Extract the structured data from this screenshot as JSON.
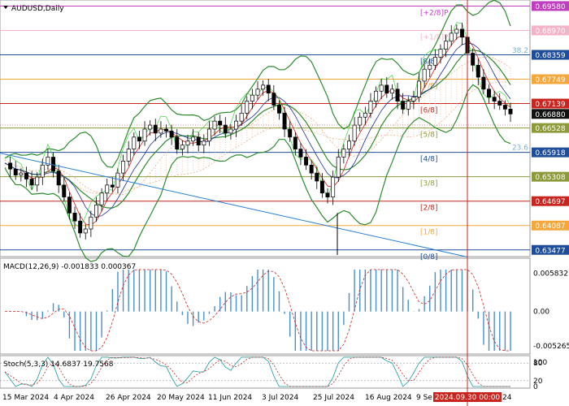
{
  "chart_data": {
    "type": "candlestick",
    "symbol_label": "AUDUSD,Daily",
    "x_ticks": [
      "15 Mar 2024",
      "4 Apr 2024",
      "26 Apr 2024",
      "20 May 2024",
      "11 Jun 2024",
      "3 Jul 2024",
      "25 Jul 2024",
      "16 Aug 2024",
      "9 Se"
    ],
    "x_tail_label": "24",
    "cursor_time": "2024.09.30 00:00",
    "price_panel": {
      "ylim": [
        0.6335,
        0.6965
      ],
      "cursor_price": "0.6688",
      "price_tags": [
        {
          "value": 0.6958,
          "label": "0.69580",
          "color": "#c03ec0"
        },
        {
          "value": 0.6897,
          "label": "0.68970",
          "color": "#f3b3c8"
        },
        {
          "value": 0.68359,
          "label": "0.68359",
          "color": "#1f4d9a"
        },
        {
          "value": 0.67749,
          "label": "0.67749",
          "color": "#f4a73a"
        },
        {
          "value": 0.67139,
          "label": "0.67139",
          "color": "#c8251f"
        },
        {
          "value": 0.6688,
          "label": "0.66880",
          "color": "#111111"
        },
        {
          "value": 0.66528,
          "label": "0.66528",
          "color": "#8e9a3a"
        },
        {
          "value": 0.65918,
          "label": "0.65918",
          "color": "#1f4d9a"
        },
        {
          "value": 0.65308,
          "label": "0.65308",
          "color": "#8e9a3a"
        },
        {
          "value": 0.64697,
          "label": "0.64697",
          "color": "#c8251f"
        },
        {
          "value": 0.64087,
          "label": "0.64087",
          "color": "#f4a73a"
        },
        {
          "value": 0.63477,
          "label": "0.63477",
          "color": "#1f4d9a"
        }
      ],
      "murrey_levels": [
        {
          "label": "[+2/8]P",
          "value": 0.6958,
          "color": "#c03ec0"
        },
        {
          "label": "[+1/8]P",
          "value": 0.6897,
          "color": "#f3b3c8"
        },
        {
          "label": "[8/8]",
          "value": 0.68359,
          "color": "#1f4d9a"
        },
        {
          "label": "[7/8]",
          "value": 0.67749,
          "color": "#f4a73a"
        },
        {
          "label": "[6/8]",
          "value": 0.67139,
          "color": "#c8251f"
        },
        {
          "label": "[5/8]",
          "value": 0.66528,
          "color": "#8e9a3a"
        },
        {
          "label": "[4/8]",
          "value": 0.65918,
          "color": "#1f4d9a"
        },
        {
          "label": "[3/8]",
          "value": 0.65308,
          "color": "#8e9a3a"
        },
        {
          "label": "[2/8]",
          "value": 0.64697,
          "color": "#c8251f"
        },
        {
          "label": "[1/8]",
          "value": 0.64087,
          "color": "#f4a73a"
        },
        {
          "label": "[0/8]",
          "value": 0.63477,
          "color": "#1f4d9a"
        }
      ],
      "fib_labels": [
        {
          "label": "38.2",
          "value": 0.6837
        },
        {
          "label": "23.6",
          "value": 0.6594
        }
      ],
      "price_path": [
        0.6565,
        0.655,
        0.6535,
        0.654,
        0.6525,
        0.651,
        0.653,
        0.656,
        0.658,
        0.6545,
        0.651,
        0.648,
        0.644,
        0.642,
        0.639,
        0.64,
        0.643,
        0.646,
        0.649,
        0.651,
        0.6505,
        0.654,
        0.657,
        0.66,
        0.663,
        0.662,
        0.665,
        0.666,
        0.664,
        0.665,
        0.6645,
        0.663,
        0.66,
        0.661,
        0.662,
        0.663,
        0.661,
        0.662,
        0.665,
        0.667,
        0.666,
        0.664,
        0.665,
        0.667,
        0.669,
        0.672,
        0.6735,
        0.675,
        0.676,
        0.674,
        0.671,
        0.669,
        0.665,
        0.663,
        0.66,
        0.658,
        0.656,
        0.654,
        0.652,
        0.649,
        0.648,
        0.653,
        0.658,
        0.66,
        0.662,
        0.666,
        0.668,
        0.669,
        0.672,
        0.6745,
        0.676,
        0.674,
        0.675,
        0.672,
        0.67,
        0.672,
        0.673,
        0.677,
        0.68,
        0.681,
        0.683,
        0.685,
        0.687,
        0.689,
        0.69,
        0.688,
        0.684,
        0.681,
        0.678,
        0.675,
        0.673,
        0.672,
        0.671,
        0.67,
        0.6688
      ]
    },
    "macd_panel": {
      "label": "MACD(12,26,9) -0.001833 0.000367",
      "axis_labels": [
        "0.005832",
        "0.00",
        "-0.005265"
      ],
      "ylim": [
        -0.006,
        0.0064
      ]
    },
    "stoch_panel": {
      "label": "Stoch(5,3,3) 14.6837 19.7568",
      "axis_labels": [
        "100",
        "80",
        "20",
        "0"
      ],
      "ylim": [
        0,
        100
      ]
    }
  }
}
